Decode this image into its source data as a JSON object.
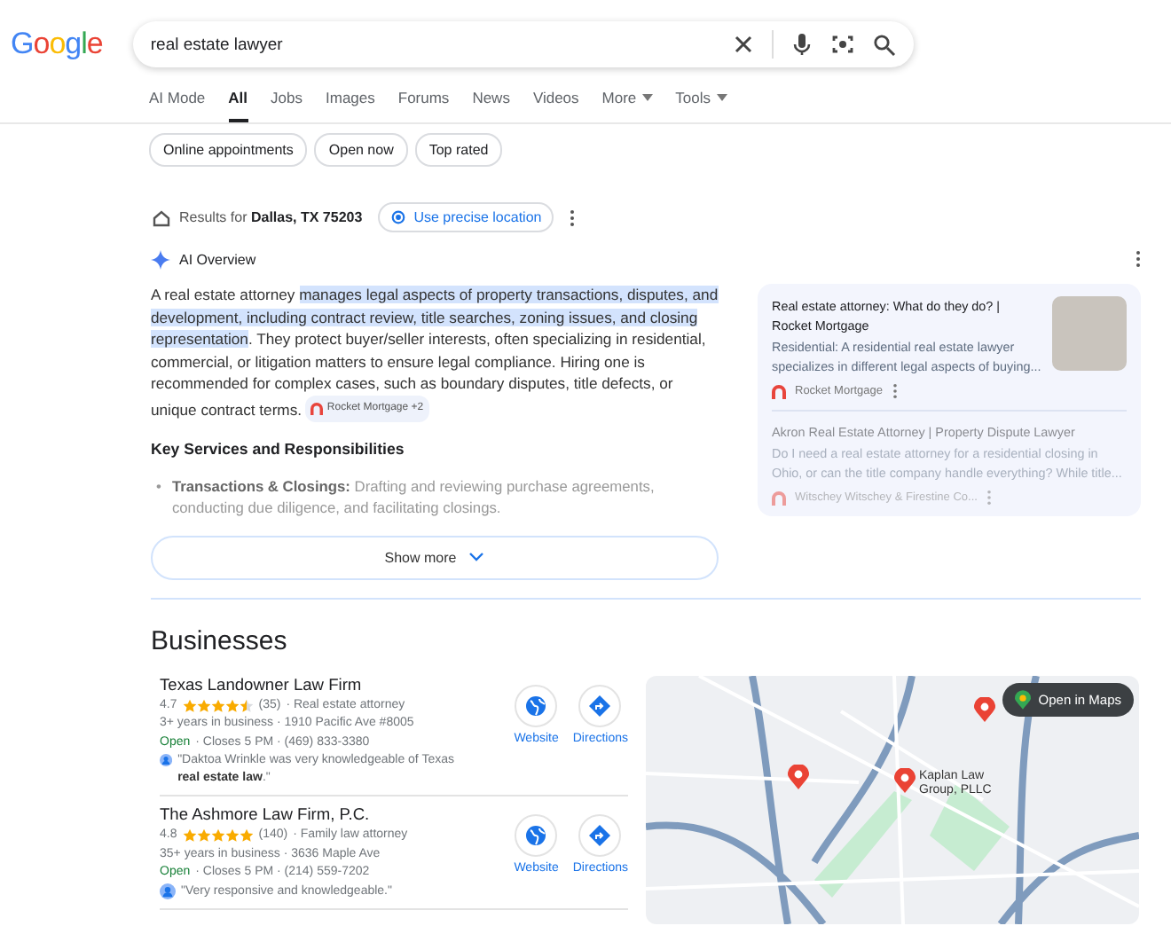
{
  "logo": "Google",
  "search": {
    "value": "real estate lawyer"
  },
  "tabs": [
    {
      "label": "AI Mode",
      "selected": false,
      "dropdown": false
    },
    {
      "label": "All",
      "selected": true,
      "dropdown": false
    },
    {
      "label": "Jobs",
      "selected": false,
      "dropdown": false
    },
    {
      "label": "Images",
      "selected": false,
      "dropdown": false
    },
    {
      "label": "Forums",
      "selected": false,
      "dropdown": false
    },
    {
      "label": "News",
      "selected": false,
      "dropdown": false
    },
    {
      "label": "Videos",
      "selected": false,
      "dropdown": false
    },
    {
      "label": "More",
      "selected": false,
      "dropdown": true
    },
    {
      "label": "Tools",
      "selected": false,
      "dropdown": true
    }
  ],
  "chips": [
    "Online appointments",
    "Open now",
    "Top rated"
  ],
  "location": {
    "prefix": "Results for",
    "place": "Dallas, TX 75203",
    "button": "Use precise location"
  },
  "ai_overview": {
    "title": "AI Overview",
    "paragraph": {
      "before": "A real estate attorney ",
      "highlight": "manages legal aspects of property transactions, disputes, and development, including contract review, title searches, zoning issues, and closing representation",
      "after": ". They protect buyer/seller interests, often specializing in residential, commercial, or litigation matters to ensure legal compliance. Hiring one is recommended for complex cases, such as boundary disputes, title defects, or unique contract terms. ",
      "citation": "Rocket Mortgage +2"
    },
    "heading": "Key Services and Responsibilities",
    "bullets": [
      {
        "marker": "•",
        "text": "**Transactions & Closings:** Drafting and reviewing purchase agreements, conducting due diligence, and facilitating closings."
      }
    ],
    "show_more": "Show more",
    "sources": [
      {
        "title": "Real estate attorney: What do they do? | Rocket Mortgage",
        "snippet": "Residential: A residential real estate lawyer specializes in different legal aspects of buying...",
        "site": "Rocket Mortgage",
        "photo": true,
        "faded": false
      },
      {
        "title": "Akron Real Estate Attorney | Property Dispute Lawyer",
        "snippet": "Do I need a real estate attorney for a residential closing in Ohio, or can the title company handle everything? While title...",
        "site": "Witschey Witschey & Firestine Co...",
        "photo": false,
        "faded": true
      }
    ]
  },
  "businesses": {
    "title": "Businesses",
    "items": [
      {
        "name": "Texas Landowner Law Firm",
        "rating": "4.7",
        "stars": 4.5,
        "reviews": "(35)",
        "category": "· Real estate attorney",
        "details": "3+ years in business · 1910 Pacific Ave #8005",
        "status": "Open",
        "hours": "· Closes 5 PM · (469) 833-3380",
        "review": "\"Daktoa Wrinkle was very knowledgeable of Texas **real estate law**.\"",
        "website": "Website",
        "directions": "Directions"
      },
      {
        "name": "The Ashmore Law Firm, P.C.",
        "rating": "4.8",
        "stars": 5,
        "reviews": "(140)",
        "category": "· Family law attorney",
        "details": "35+ years in business · 3636 Maple Ave",
        "status": "Open",
        "hours": "· Closes 5 PM · (214) 559-7202",
        "review": "\"Very responsive and knowledgeable.\"",
        "website": "Website",
        "directions": "Directions"
      }
    ],
    "map": {
      "open_button": "Open in Maps",
      "pin_label": "Kaplan Law Group, PLLC"
    }
  }
}
